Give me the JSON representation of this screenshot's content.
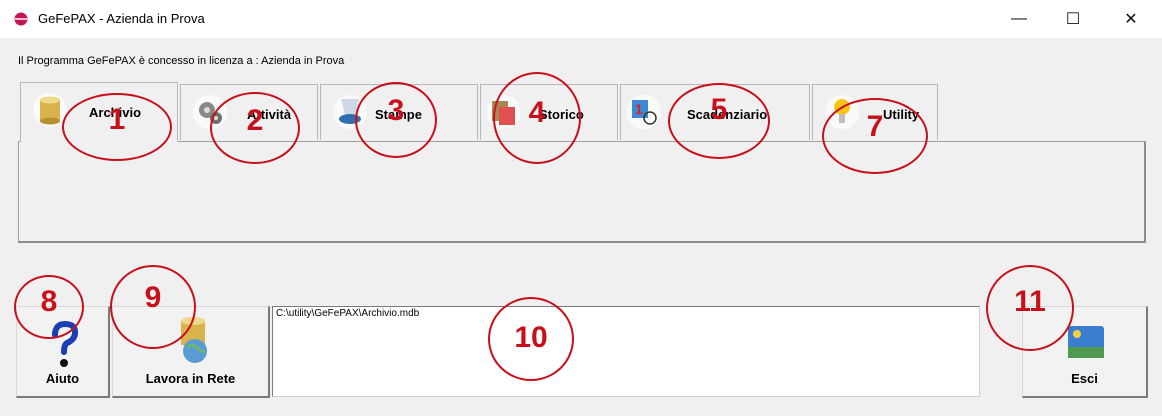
{
  "window": {
    "title": "GeFePAX - Azienda in Prova",
    "controls": {
      "minimize": "—",
      "maximize": "☐",
      "close": "✕"
    }
  },
  "license_text": "Il Programma GeFePAX è concesso in licenza a : Azienda in Prova",
  "tabs": [
    {
      "label": "Archivio",
      "icon": "database-icon",
      "active": true
    },
    {
      "label": "Attività",
      "icon": "gears-icon"
    },
    {
      "label": "Stampe",
      "icon": "printer-icon"
    },
    {
      "label": "Storico",
      "icon": "history-icon"
    },
    {
      "label": "Scadenziario",
      "icon": "calendar-clock-icon"
    },
    {
      "label": "Utility",
      "icon": "lightbulb-icon"
    }
  ],
  "buttons": {
    "help": {
      "label": "Aiuto",
      "icon": "question-mark-icon"
    },
    "network": {
      "label": "Lavora in Rete",
      "icon": "network-database-icon"
    },
    "exit": {
      "label": "Esci",
      "icon": "exit-landscape-icon"
    }
  },
  "path_field": {
    "value": "C:\\utility\\GeFePAX\\Archivio.mdb"
  },
  "annotations": [
    "1",
    "2",
    "3",
    "5",
    "4",
    "7",
    "8",
    "9",
    "10",
    "11"
  ],
  "colors": {
    "annotation_red": "#c8101a",
    "window_bg": "#f0f0f0"
  }
}
